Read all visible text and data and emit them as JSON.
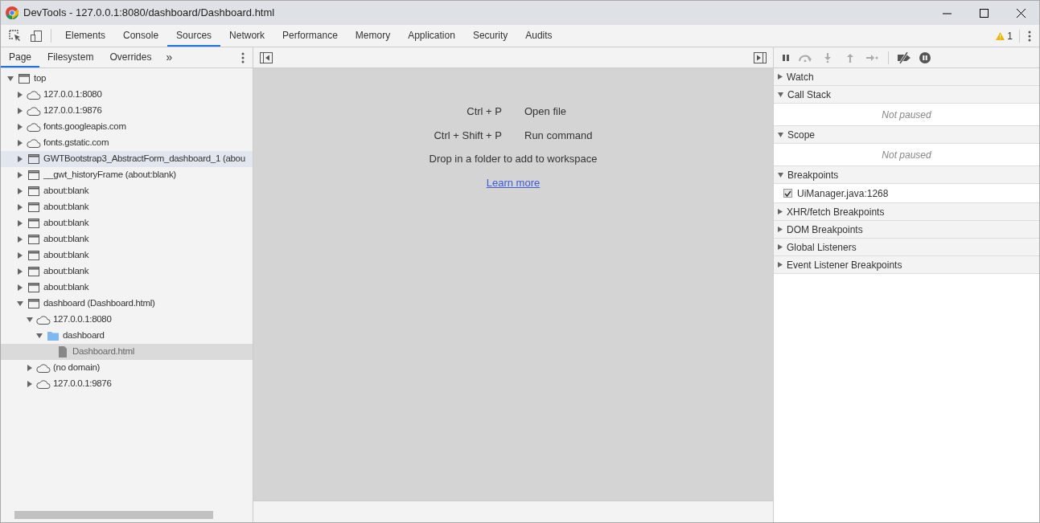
{
  "window": {
    "title": "DevTools - 127.0.0.1:8080/dashboard/Dashboard.html"
  },
  "main_tabs": [
    {
      "label": "Elements",
      "selected": false
    },
    {
      "label": "Console",
      "selected": false
    },
    {
      "label": "Sources",
      "selected": true
    },
    {
      "label": "Network",
      "selected": false
    },
    {
      "label": "Performance",
      "selected": false
    },
    {
      "label": "Memory",
      "selected": false
    },
    {
      "label": "Application",
      "selected": false
    },
    {
      "label": "Security",
      "selected": false
    },
    {
      "label": "Audits",
      "selected": false
    }
  ],
  "warning_count": "1",
  "navigator": {
    "tabs": [
      {
        "label": "Page",
        "selected": true
      },
      {
        "label": "Filesystem",
        "selected": false
      },
      {
        "label": "Overrides",
        "selected": false
      }
    ],
    "more": "»",
    "tree": [
      {
        "label": "top",
        "kind": "frame",
        "expanded": true,
        "highlighted": false,
        "selected": false,
        "children": [
          {
            "label": "127.0.0.1:8080",
            "kind": "cloud",
            "expanded": false,
            "highlighted": false,
            "selected": false
          },
          {
            "label": "127.0.0.1:9876",
            "kind": "cloud",
            "expanded": false,
            "highlighted": false,
            "selected": false
          },
          {
            "label": "fonts.googleapis.com",
            "kind": "cloud",
            "expanded": false,
            "highlighted": false,
            "selected": false
          },
          {
            "label": "fonts.gstatic.com",
            "kind": "cloud",
            "expanded": false,
            "highlighted": false,
            "selected": false
          },
          {
            "label": "GWTBootstrap3_AbstractForm_dashboard_1 (abou",
            "kind": "frame",
            "expanded": false,
            "highlighted": true,
            "selected": false
          },
          {
            "label": "__gwt_historyFrame (about:blank)",
            "kind": "frame",
            "expanded": false,
            "highlighted": false,
            "selected": false
          },
          {
            "label": "about:blank",
            "kind": "frame",
            "expanded": false,
            "highlighted": false,
            "selected": false
          },
          {
            "label": "about:blank",
            "kind": "frame",
            "expanded": false,
            "highlighted": false,
            "selected": false
          },
          {
            "label": "about:blank",
            "kind": "frame",
            "expanded": false,
            "highlighted": false,
            "selected": false
          },
          {
            "label": "about:blank",
            "kind": "frame",
            "expanded": false,
            "highlighted": false,
            "selected": false
          },
          {
            "label": "about:blank",
            "kind": "frame",
            "expanded": false,
            "highlighted": false,
            "selected": false
          },
          {
            "label": "about:blank",
            "kind": "frame",
            "expanded": false,
            "highlighted": false,
            "selected": false
          },
          {
            "label": "about:blank",
            "kind": "frame",
            "expanded": false,
            "highlighted": false,
            "selected": false
          },
          {
            "label": "dashboard (Dashboard.html)",
            "kind": "frame",
            "expanded": true,
            "highlighted": false,
            "selected": false,
            "children": [
              {
                "label": "127.0.0.1:8080",
                "kind": "cloud",
                "expanded": true,
                "highlighted": false,
                "selected": false,
                "children": [
                  {
                    "label": "dashboard",
                    "kind": "folder",
                    "expanded": true,
                    "highlighted": false,
                    "selected": false,
                    "children": [
                      {
                        "label": "Dashboard.html",
                        "kind": "file",
                        "selected": true
                      }
                    ]
                  }
                ]
              },
              {
                "label": "(no domain)",
                "kind": "cloud",
                "expanded": false,
                "highlighted": false,
                "selected": false
              },
              {
                "label": "127.0.0.1:9876",
                "kind": "cloud",
                "expanded": false,
                "highlighted": false,
                "selected": false
              }
            ]
          }
        ]
      }
    ]
  },
  "editor": {
    "shortcuts": [
      {
        "keys": "Ctrl + P",
        "action": "Open file"
      },
      {
        "keys": "Ctrl + Shift + P",
        "action": "Run command"
      }
    ],
    "hint": "Drop in a folder to add to workspace",
    "link": "Learn more"
  },
  "debugger": {
    "sections": [
      {
        "title": "Watch",
        "expanded": false
      },
      {
        "title": "Call Stack",
        "expanded": true,
        "message": "Not paused"
      },
      {
        "title": "Scope",
        "expanded": true,
        "message": "Not paused"
      },
      {
        "title": "Breakpoints",
        "expanded": true,
        "breakpoints": [
          {
            "label": "UiManager.java:1268",
            "checked": true
          }
        ]
      },
      {
        "title": "XHR/fetch Breakpoints",
        "expanded": false
      },
      {
        "title": "DOM Breakpoints",
        "expanded": false
      },
      {
        "title": "Global Listeners",
        "expanded": false
      },
      {
        "title": "Event Listener Breakpoints",
        "expanded": false
      }
    ]
  }
}
